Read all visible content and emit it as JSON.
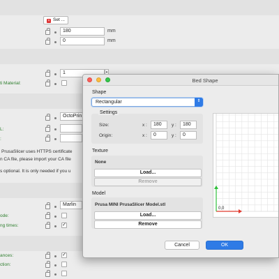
{
  "background": {
    "set_button_label": "Set ...",
    "field_180": "180",
    "field_0": "0",
    "unit_mm_1": "mm",
    "unit_mm_2": "mm",
    "field_1": "1",
    "ti_material_label": "ti Material:",
    "octoprint_field": "OctoPrin",
    "l_label": "L:",
    "colon_label": ":",
    "https_note": "PrusaSlicer uses HTTPS certificate",
    "ca_note": "n CA file, please import your CA file",
    "optional_note": "s optional. It is only needed if you u",
    "marlin_field": "Marlin",
    "ode_label": "ode:",
    "ng_times_label": "ng times:",
    "ances_label": "ances:",
    "ction_label": "ction:",
    "check_mark": "✓"
  },
  "dialog": {
    "title": "Bed Shape",
    "shape_label": "Shape",
    "shape_value": "Rectangular",
    "settings_label": "Settings",
    "size_label": "Size:",
    "origin_label": "Origin:",
    "x_label": "x :",
    "y_label": "y :",
    "size_x": "180",
    "size_y": "180",
    "origin_x": "0",
    "origin_y": "0",
    "texture_label": "Texture",
    "texture_value": "None",
    "load_label": "Load...",
    "remove_label": "Remove",
    "model_label": "Model",
    "model_value": "Prusa MINI PrusaSlicer Model.stl",
    "cancel_label": "Cancel",
    "ok_label": "OK",
    "origin_text": "0,0"
  },
  "colors": {
    "accent": "#2f7be6",
    "green_label": "#2f7f2f",
    "axis_x": "#e03a2f",
    "axis_y": "#2fbf3a"
  }
}
